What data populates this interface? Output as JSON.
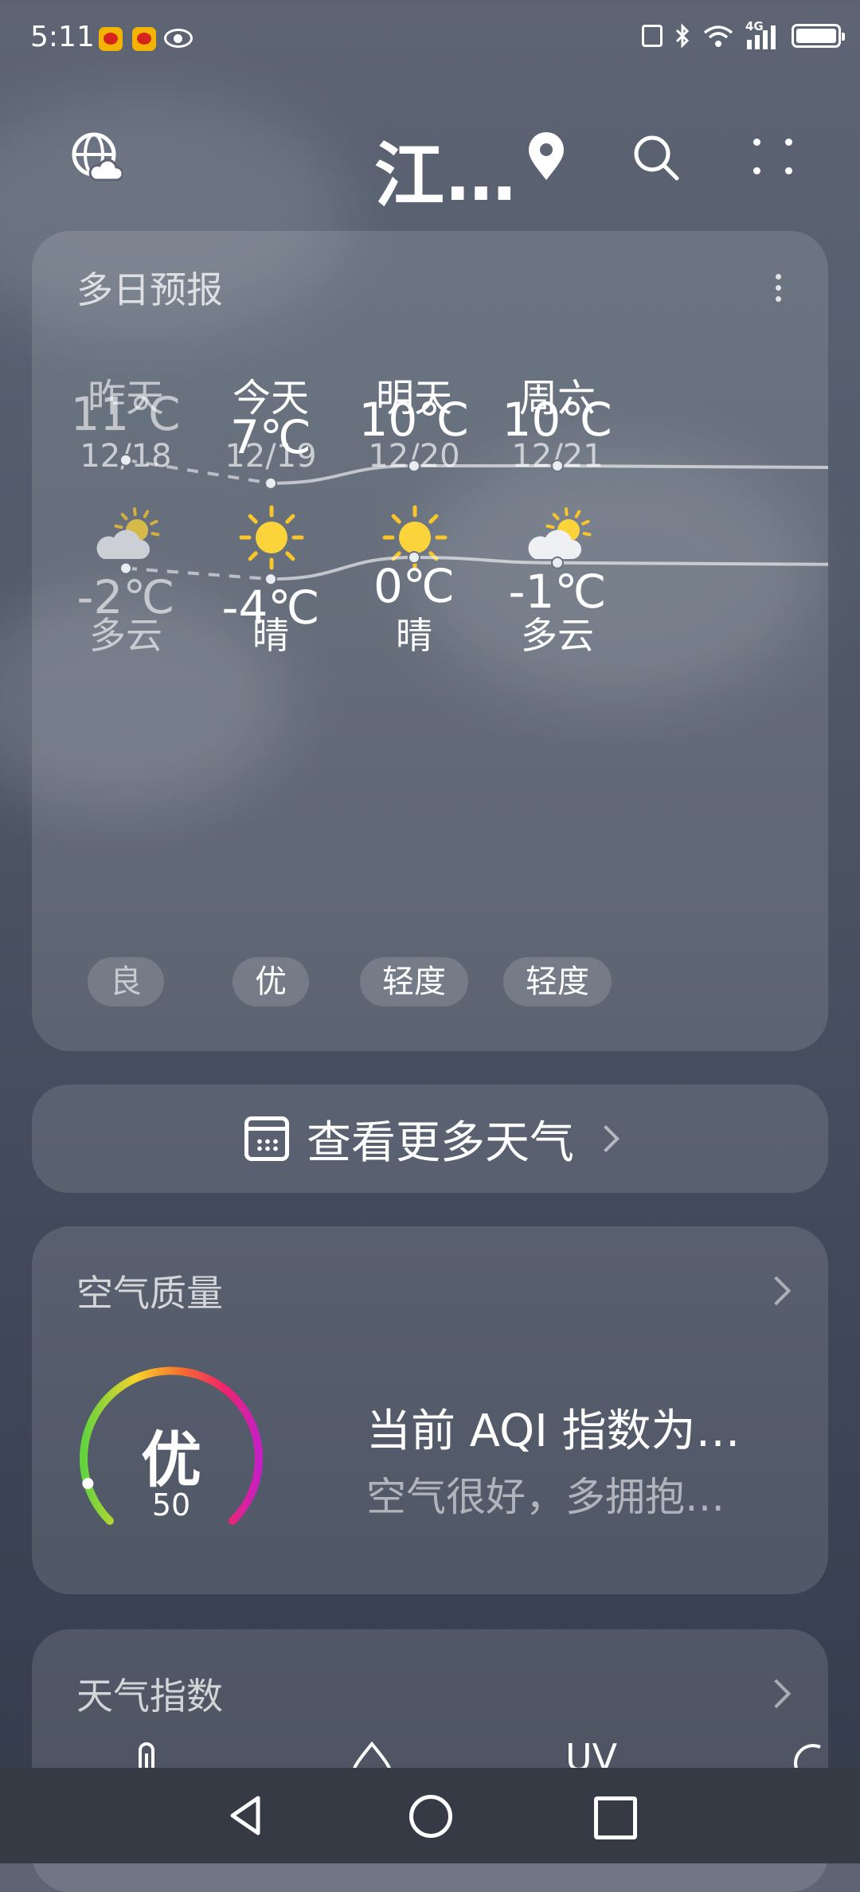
{
  "status_bar": {
    "time": "5:11",
    "network": "4G",
    "icons": [
      "weibo-icon",
      "weibo-icon",
      "eye-icon",
      "nfc-icon",
      "bluetooth-icon",
      "wifi-icon",
      "signal-icon",
      "battery-icon"
    ]
  },
  "header": {
    "city": "江…",
    "icons": [
      "globe-weather-icon",
      "location-pin-icon",
      "search-icon",
      "more-dots-icon"
    ]
  },
  "forecast": {
    "title": "多日预报",
    "days": [
      {
        "name": "昨天",
        "date": "12/18",
        "icon": "partly-cloudy-icon",
        "desc": "多云",
        "high": "11℃",
        "low": "-2℃",
        "aqi": "良",
        "past": true
      },
      {
        "name": "今天",
        "date": "12/19",
        "icon": "sun-icon",
        "desc": "晴",
        "high": "7℃",
        "low": "-4℃",
        "aqi": "优",
        "past": false
      },
      {
        "name": "明天",
        "date": "12/20",
        "icon": "sun-icon",
        "desc": "晴",
        "high": "10℃",
        "low": "0℃",
        "aqi": "轻度",
        "past": false
      },
      {
        "name": "周六",
        "date": "12/21",
        "icon": "partly-cloudy-icon",
        "desc": "多云",
        "high": "10℃",
        "low": "-1℃",
        "aqi": "轻度",
        "past": false
      }
    ],
    "high_values": [
      11,
      7,
      10,
      10
    ],
    "low_values": [
      -2,
      -4,
      0,
      -1
    ]
  },
  "more_weather": {
    "label": "查看更多天气",
    "icon": "calendar-icon"
  },
  "air_quality": {
    "title": "空气质量",
    "level": "优",
    "aqi": "50",
    "aqi_value": 50,
    "headline": "当前 AQI 指数为…",
    "subtitle": "空气很好，多拥抱…"
  },
  "weather_index": {
    "title": "天气指数",
    "items": [
      "thermometer-icon",
      "raindrop-icon",
      "UV",
      "wind-icon"
    ]
  },
  "nav": {
    "items": [
      "back-icon",
      "home-icon",
      "recents-icon"
    ]
  }
}
